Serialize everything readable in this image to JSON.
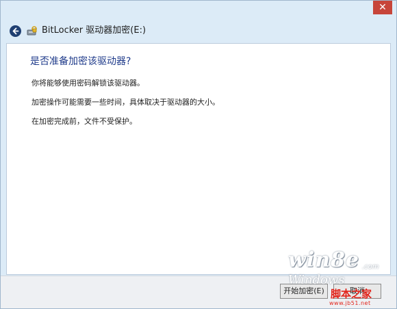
{
  "window": {
    "close_label": "✕"
  },
  "nav": {
    "title": "BitLocker 驱动器加密(E:)"
  },
  "main": {
    "heading": "是否准备加密该驱动器?",
    "paragraphs": [
      "你将能够使用密码解锁该驱动器。",
      "加密操作可能需要一些时间，具体取决于驱动器的大小。",
      "在加密完成前，文件不受保护。"
    ]
  },
  "footer": {
    "start_label": "开始加密(E)",
    "cancel_label": "取消"
  },
  "watermark": {
    "site_logo": "win8e",
    "site_suffix": ".com",
    "site_tagline": "Windows",
    "jb_name": "脚本之家",
    "jb_url": "www.jb51.net"
  },
  "colors": {
    "heading": "#1e3a8a",
    "close_button": "#c7453a",
    "window_frame": "#dcebf7",
    "content_bg": "#ffffff",
    "footer_bg": "#eef0f3",
    "watermark_red": "#e2231a"
  },
  "icons": {
    "back": "back-arrow-icon",
    "app": "bitlocker-drive-icon",
    "close": "close-icon"
  }
}
